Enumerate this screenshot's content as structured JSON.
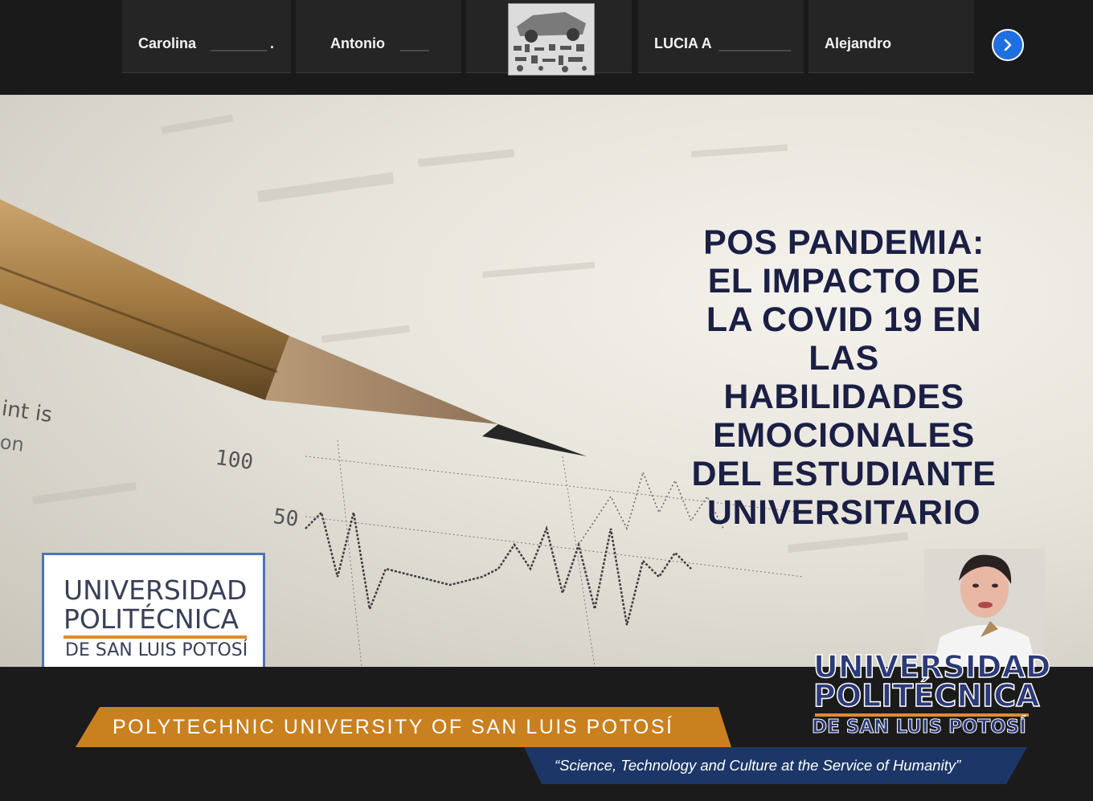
{
  "participants": [
    {
      "name": "Carolina",
      "suffix": "."
    },
    {
      "name": "Antonio",
      "suffix": ""
    },
    {
      "name": "",
      "suffix": ""
    },
    {
      "name": "LUCIA A",
      "suffix": ""
    },
    {
      "name": "Alejandro",
      "suffix": ""
    }
  ],
  "icons": {
    "next": "chevron-right-icon"
  },
  "colors": {
    "accent_blue": "#1e6fe0",
    "title_navy": "#1b1f44",
    "band_orange": "#c9801f",
    "band_blue": "#1c3767"
  },
  "slide": {
    "title_lines": [
      "POS PANDEMIA:",
      "EL IMPACTO DE",
      "LA COVID 19 EN",
      "LAS",
      "HABILIDADES",
      "EMOCIONALES",
      "DEL ESTUDIANTE",
      "UNIVERSITARIO"
    ],
    "paper_text_1": "int is",
    "paper_text_2": "on",
    "paper_tick_100": "100",
    "paper_tick_50": "50",
    "logo": {
      "line1": "UNIVERSIDAD",
      "line2": "POLITÉCNICA",
      "line3": "DE SAN LUIS POTOSÍ"
    }
  },
  "banner": {
    "university_english": "POLYTECHNIC UNIVERSITY OF SAN LUIS POTOSÍ",
    "motto": "“Science, Technology and Culture at the Service of Humanity”",
    "logo": {
      "line1": "UNIVERSIDAD",
      "line2": "POLITÉCNICA",
      "line3": "DE SAN LUIS POTOSÍ"
    }
  }
}
